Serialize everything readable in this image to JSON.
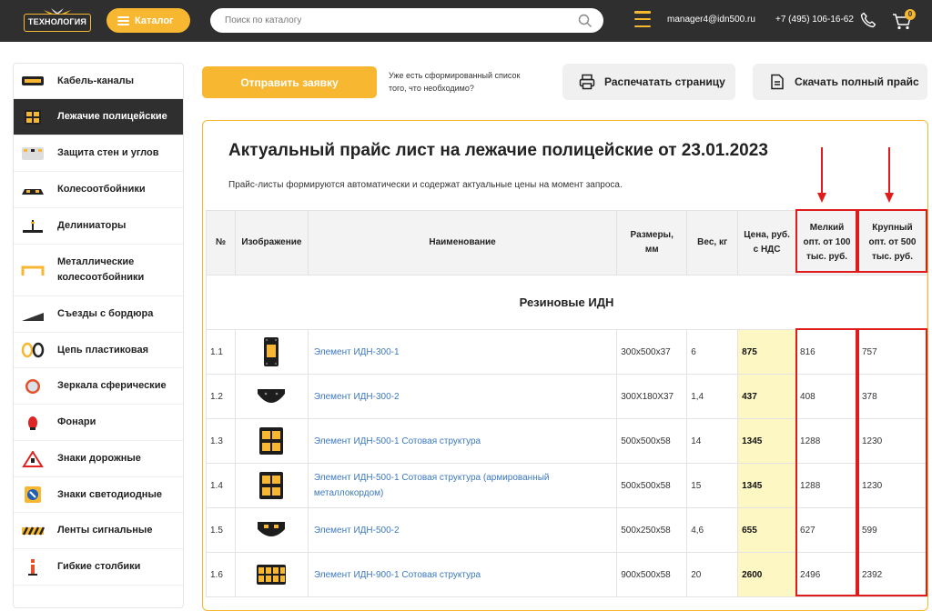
{
  "header": {
    "logo_text": "ТЕХНОЛОГИЯ",
    "catalog_label": "Каталог",
    "search_placeholder": "Поиск по каталогу",
    "email": "manager4@idn500.ru",
    "phone": "+7 (495) 106-16-62",
    "cart_count": "0"
  },
  "sidebar": {
    "items": [
      {
        "label": "Кабель-каналы",
        "icon": "cable-channel-icon",
        "active": false
      },
      {
        "label": "Лежачие полицейские",
        "icon": "speed-bump-icon",
        "active": true
      },
      {
        "label": "Защита стен и углов",
        "icon": "wall-protector-icon",
        "active": false
      },
      {
        "label": "Колесоотбойники",
        "icon": "wheel-stop-icon",
        "active": false
      },
      {
        "label": "Делиниаторы",
        "icon": "delineator-icon",
        "active": false
      },
      {
        "label": "Металлические колесоотбойники",
        "icon": "metal-wheel-stop-icon",
        "active": false
      },
      {
        "label": "Съезды с бордюра",
        "icon": "curb-ramp-icon",
        "active": false
      },
      {
        "label": "Цепь пластиковая",
        "icon": "plastic-chain-icon",
        "active": false
      },
      {
        "label": "Зеркала сферические",
        "icon": "spherical-mirror-icon",
        "active": false
      },
      {
        "label": "Фонари",
        "icon": "lantern-icon",
        "active": false
      },
      {
        "label": "Знаки дорожные",
        "icon": "road-sign-icon",
        "active": false
      },
      {
        "label": "Знаки светодиодные",
        "icon": "led-sign-icon",
        "active": false
      },
      {
        "label": "Ленты сигнальные",
        "icon": "signal-tape-icon",
        "active": false
      },
      {
        "label": "Гибкие столбики",
        "icon": "flexible-post-icon",
        "active": false
      }
    ]
  },
  "toolbar": {
    "order_label": "Отправить заявку",
    "order_hint": "Уже есть сформированный список того, что необходимо?",
    "print_label": "Распечатать страницу",
    "download_label": "Скачать полный прайс"
  },
  "price_list": {
    "title": "Актуальный прайс лист на лежачие полицейские от 23.01.2023",
    "subtitle": "Прайс-листы формируются автоматически и содержат актуальные цены на момент запроса.",
    "columns": {
      "num": "№",
      "image": "Изображение",
      "name": "Наименование",
      "size": "Размеры, мм",
      "weight": "Вес, кг",
      "price": "Цена, руб. с НДС",
      "small_wholesale": "Мелкий опт. от 100 тыс. руб.",
      "large_wholesale": "Крупный опт. от 500 тыс. руб."
    },
    "section": "Резиновые ИДН",
    "rows": [
      {
        "num": "1.1",
        "name": "Элемент ИДН-300-1",
        "size": "300x500x37",
        "weight": "6",
        "price": "875",
        "small": "816",
        "large": "757",
        "image": "idn-300-1-image"
      },
      {
        "num": "1.2",
        "name": "Элемент ИДН-300-2",
        "size": "300X180X37",
        "weight": "1,4",
        "price": "437",
        "small": "408",
        "large": "378",
        "image": "idn-300-2-image"
      },
      {
        "num": "1.3",
        "name": "Элемент ИДН-500-1 Сотовая структура",
        "size": "500x500x58",
        "weight": "14",
        "price": "1345",
        "small": "1288",
        "large": "1230",
        "image": "idn-500-1-image"
      },
      {
        "num": "1.4",
        "name": "Элемент ИДН-500-1 Сотовая структура (армированный металлокордом)",
        "size": "500x500x58",
        "weight": "15",
        "price": "1345",
        "small": "1288",
        "large": "1230",
        "image": "idn-500-1-reinforced-image"
      },
      {
        "num": "1.5",
        "name": "Элемент ИДН-500-2",
        "size": "500x250x58",
        "weight": "4,6",
        "price": "655",
        "small": "627",
        "large": "599",
        "image": "idn-500-2-image"
      },
      {
        "num": "1.6",
        "name": "Элемент ИДН-900-1 Сотовая структура",
        "size": "900x500x58",
        "weight": "20",
        "price": "2600",
        "small": "2496",
        "large": "2392",
        "image": "idn-900-1-image"
      }
    ]
  },
  "colors": {
    "accent": "#f7b731",
    "header_bg": "#2f2f2f",
    "price_highlight": "#fdf7c3",
    "link": "#3c78c0",
    "annotation_red": "#e01b1b"
  }
}
